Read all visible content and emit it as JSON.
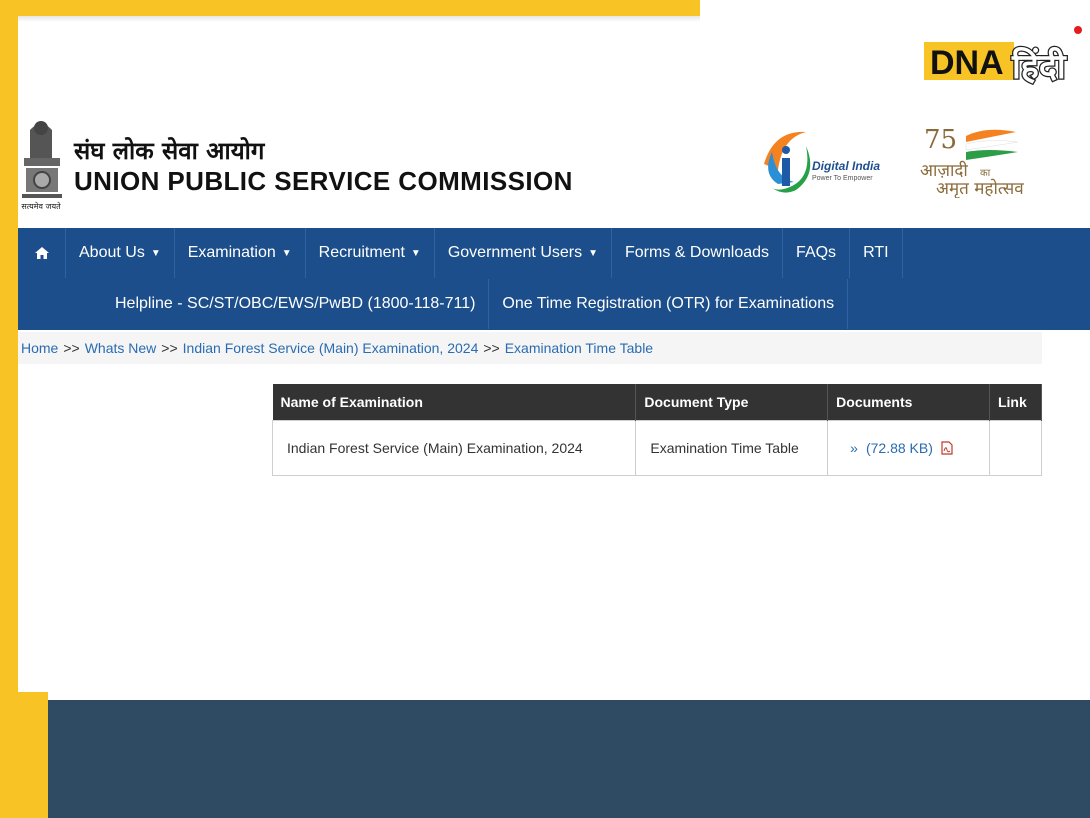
{
  "brand": {
    "dna_text": "DNA",
    "dna_hindi": "हिंदी"
  },
  "header": {
    "title_hindi": "संघ लोक सेवा आयोग",
    "title_english": "UNION PUBLIC SERVICE COMMISSION",
    "emblem_motto": "सत्यमेव जयते",
    "digital_india_title": "Digital India",
    "digital_india_tagline": "Power To Empower",
    "azadi_line1": "आज़ादी",
    "azadi_ka": "का",
    "azadi_line2": "अमृत महोत्सव",
    "azadi_number": "75"
  },
  "nav": {
    "home_icon": "home-icon",
    "row1": [
      {
        "label": "About Us",
        "dropdown": true
      },
      {
        "label": "Examination",
        "dropdown": true
      },
      {
        "label": "Recruitment",
        "dropdown": true
      },
      {
        "label": "Government Users",
        "dropdown": true
      },
      {
        "label": "Forms & Downloads",
        "dropdown": false
      },
      {
        "label": "FAQs",
        "dropdown": false
      },
      {
        "label": "RTI",
        "dropdown": false
      }
    ],
    "row2": [
      {
        "label": "Helpline - SC/ST/OBC/EWS/PwBD (1800-118-711)"
      },
      {
        "label": "One Time Registration (OTR) for Examinations"
      }
    ]
  },
  "breadcrumb": {
    "items": [
      "Home",
      "Whats New",
      "Indian Forest Service (Main) Examination, 2024",
      "Examination Time Table"
    ],
    "separator": ">>"
  },
  "table": {
    "headers": [
      "Name of Examination",
      "Document Type",
      "Documents",
      "Link"
    ],
    "rows": [
      {
        "name": "Indian Forest Service (Main) Examination, 2024",
        "doc_type": "Examination Time Table",
        "doc_marker": "»",
        "doc_size": "(72.88 KB)",
        "link": ""
      }
    ]
  },
  "colors": {
    "nav_bg": "#1b4e8a",
    "frame_yellow": "#f7c325",
    "footer": "#2f4a63",
    "link": "#2a6cb1",
    "table_header": "#333333"
  }
}
